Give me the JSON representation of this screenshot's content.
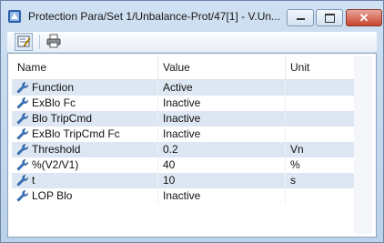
{
  "window": {
    "title": "Protection Para/Set 1/Unbalance-Prot/47[1] - V.Un..."
  },
  "toolbar": {
    "edit_icon": "edit-parameters-icon",
    "print_icon": "printer-icon"
  },
  "table": {
    "headers": {
      "name": "Name",
      "value": "Value",
      "unit": "Unit"
    },
    "rows": [
      {
        "name": "Function",
        "value": "Active",
        "unit": ""
      },
      {
        "name": "ExBlo Fc",
        "value": "Inactive",
        "unit": ""
      },
      {
        "name": "Blo TripCmd",
        "value": "Inactive",
        "unit": ""
      },
      {
        "name": "ExBlo TripCmd Fc",
        "value": "Inactive",
        "unit": ""
      },
      {
        "name": "Threshold",
        "value": "0.2",
        "unit": "Vn"
      },
      {
        "name": "%(V2/V1)",
        "value": "40",
        "unit": "%"
      },
      {
        "name": "t",
        "value": "10",
        "unit": "s"
      },
      {
        "name": "LOP Blo",
        "value": "Inactive",
        "unit": ""
      }
    ],
    "row_icon": "wrench-parameter-icon"
  },
  "colors": {
    "row_alt": "#dde7f3",
    "close_button": "#c8462f"
  }
}
